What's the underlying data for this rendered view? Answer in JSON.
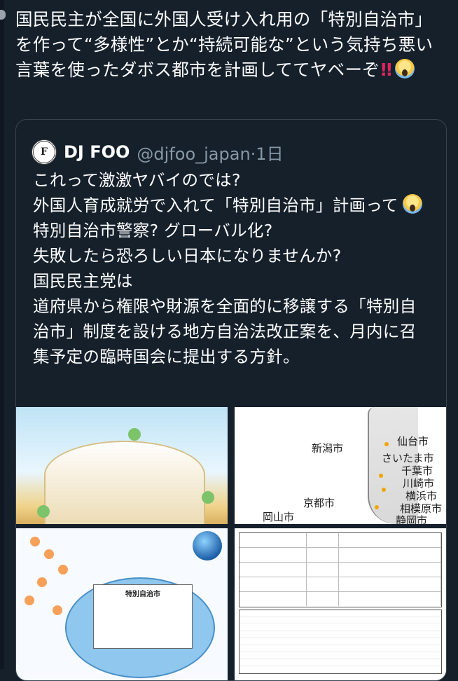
{
  "tweet": {
    "text": "国民民主が全国に外国人受け入れ用の「特別自治市」を作って“多様性”とか“持続可能な”という気持ち悪い言葉を使ったダボス都市を計画しててヤベーぞ",
    "emoji": [
      "double-exclamation",
      "screaming-face"
    ]
  },
  "quote": {
    "author_name": "DJ FOO",
    "author_handle": "@djfoo_japan",
    "time_sep": "·",
    "time": "1日",
    "text_lines": [
      "これって激激ヤバイのでは?",
      "外国人育成就労で入れて「特別自治市」計画って",
      "特別自治市警察? グローバル化?",
      "失敗したら恐ろしい日本になりませんか?",
      "国民民主党は",
      "道府県から権限や財源を全面的に移譲する「特別自治市」制度を設ける地方自治法改正案を、月内に召集予定の臨時国会に提出する方針。"
    ],
    "media": {
      "map_labels": [
        "新潟市",
        "仙台市",
        "さいたま市",
        "千葉市",
        "川崎市",
        "横浜市",
        "相模原市",
        "静岡市",
        "京都市",
        "岡山市"
      ],
      "diagram_center_title": "特別自治市"
    }
  }
}
